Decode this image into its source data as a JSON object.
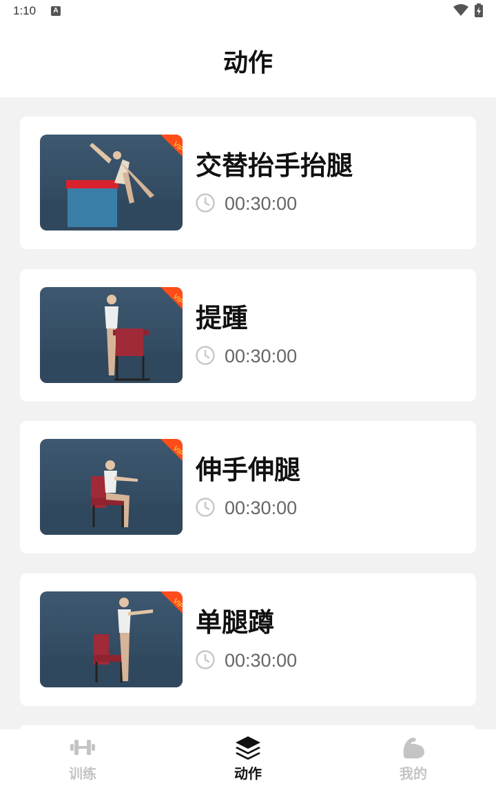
{
  "status": {
    "time": "1:10",
    "notification": "A"
  },
  "header": {
    "title": "动作"
  },
  "exercises": [
    {
      "title": "交替抬手抬腿",
      "duration": "00:30:00",
      "badge": "VIP"
    },
    {
      "title": "提踵",
      "duration": "00:30:00",
      "badge": "VIP"
    },
    {
      "title": "伸手伸腿",
      "duration": "00:30:00",
      "badge": "VIP"
    },
    {
      "title": "单腿蹲",
      "duration": "00:30:00",
      "badge": "VIP"
    }
  ],
  "tabs": [
    {
      "label": "训练",
      "icon": "dumbbell-icon",
      "active": false
    },
    {
      "label": "动作",
      "icon": "layers-icon",
      "active": true
    },
    {
      "label": "我的",
      "icon": "bicep-icon",
      "active": false
    }
  ],
  "colors": {
    "active": "#111111",
    "inactive": "#c4c4c4",
    "vip": "#ff4d1a",
    "scene": "#35506b"
  }
}
